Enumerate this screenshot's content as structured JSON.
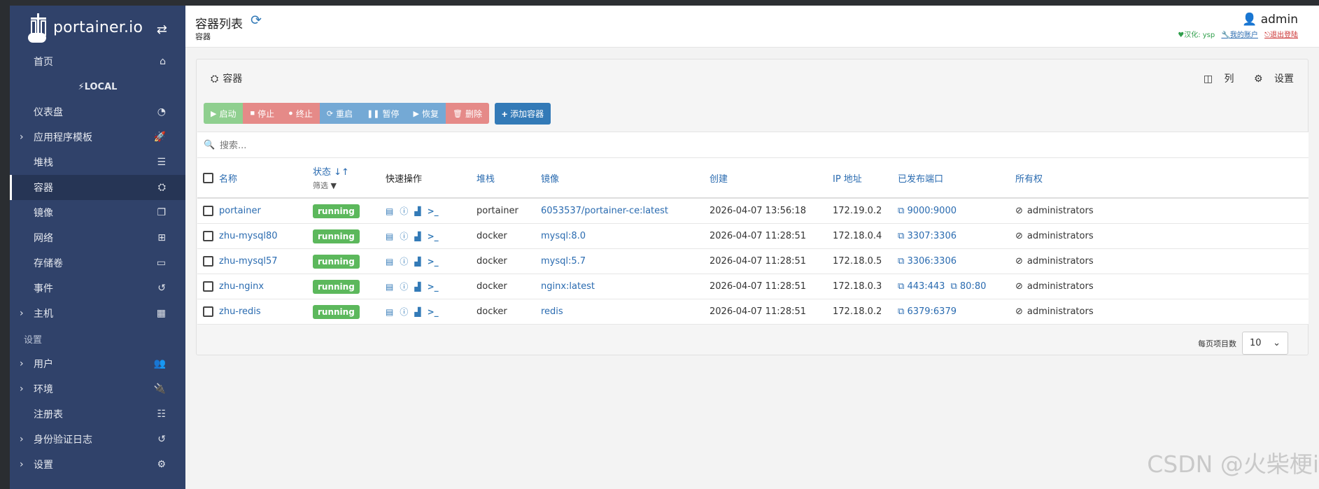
{
  "brand": {
    "name": "portainer.io",
    "toggle_icon": "arrows-swap-icon"
  },
  "sidebar": {
    "items": [
      {
        "label": "首页",
        "icon": "⌂",
        "caret": false,
        "type": "item"
      },
      {
        "label": "LOCAL",
        "icon": "",
        "caret": false,
        "type": "env",
        "prefix": "🔌"
      },
      {
        "label": "仪表盘",
        "icon": "◔",
        "caret": false,
        "type": "item"
      },
      {
        "label": "应用程序模板",
        "icon": "🚀",
        "caret": true,
        "type": "item"
      },
      {
        "label": "堆栈",
        "icon": "☰",
        "caret": false,
        "type": "item"
      },
      {
        "label": "容器",
        "icon": "⛭",
        "caret": false,
        "type": "item",
        "active": true
      },
      {
        "label": "镜像",
        "icon": "❐",
        "caret": false,
        "type": "item"
      },
      {
        "label": "网络",
        "icon": "⊞",
        "caret": false,
        "type": "item"
      },
      {
        "label": "存储卷",
        "icon": "▭",
        "caret": false,
        "type": "item"
      },
      {
        "label": "事件",
        "icon": "↺",
        "caret": false,
        "type": "item"
      },
      {
        "label": "主机",
        "icon": "▦",
        "caret": true,
        "type": "item"
      },
      {
        "label": "设置",
        "icon": "",
        "caret": false,
        "type": "section"
      },
      {
        "label": "用户",
        "icon": "👥",
        "caret": true,
        "type": "item"
      },
      {
        "label": "环境",
        "icon": "🔌",
        "caret": true,
        "type": "item"
      },
      {
        "label": "注册表",
        "icon": "☷",
        "caret": false,
        "type": "item"
      },
      {
        "label": "身份验证日志",
        "icon": "↺",
        "caret": true,
        "type": "item"
      },
      {
        "label": "设置",
        "icon": "⚙",
        "caret": true,
        "type": "item"
      }
    ]
  },
  "header": {
    "title": "容器列表",
    "breadcrumb": "容器",
    "user": "admin",
    "links": {
      "translation": "汉化: ysp",
      "account": "我的账户",
      "logout": "退出登陆"
    }
  },
  "panel": {
    "title": "容器",
    "columns_btn": "列",
    "settings_btn": "设置"
  },
  "actions": {
    "start": "启动",
    "stop": "停止",
    "kill": "终止",
    "restart": "重启",
    "pause": "暂停",
    "resume": "恢复",
    "remove": "删除",
    "add": "添加容器"
  },
  "search": {
    "placeholder": "搜索..."
  },
  "table": {
    "headers": {
      "name": "名称",
      "status": "状态",
      "filter": "筛选",
      "quick": "快速操作",
      "stack": "堆栈",
      "image": "镜像",
      "created": "创建",
      "ip": "IP 地址",
      "ports": "已发布端口",
      "ownership": "所有权"
    },
    "rows": [
      {
        "name": "portainer",
        "status": "running",
        "stack": "portainer",
        "image": "6053537/portainer-ce:latest",
        "created": "2026-04-07 13:56:18",
        "ip": "172.19.0.2",
        "ports": [
          "9000:9000"
        ],
        "ownership": "administrators"
      },
      {
        "name": "zhu-mysql80",
        "status": "running",
        "stack": "docker",
        "image": "mysql:8.0",
        "created": "2026-04-07 11:28:51",
        "ip": "172.18.0.4",
        "ports": [
          "3307:3306"
        ],
        "ownership": "administrators"
      },
      {
        "name": "zhu-mysql57",
        "status": "running",
        "stack": "docker",
        "image": "mysql:5.7",
        "created": "2026-04-07 11:28:51",
        "ip": "172.18.0.5",
        "ports": [
          "3306:3306"
        ],
        "ownership": "administrators"
      },
      {
        "name": "zhu-nginx",
        "status": "running",
        "stack": "docker",
        "image": "nginx:latest",
        "created": "2026-04-07 11:28:51",
        "ip": "172.18.0.3",
        "ports": [
          "443:443",
          "80:80"
        ],
        "ownership": "administrators"
      },
      {
        "name": "zhu-redis",
        "status": "running",
        "stack": "docker",
        "image": "redis",
        "created": "2026-04-07 11:28:51",
        "ip": "172.18.0.2",
        "ports": [
          "6379:6379"
        ],
        "ownership": "administrators"
      }
    ]
  },
  "pager": {
    "label": "每页项目数",
    "value": "10"
  },
  "watermark": "CSDN @火柴梗i"
}
